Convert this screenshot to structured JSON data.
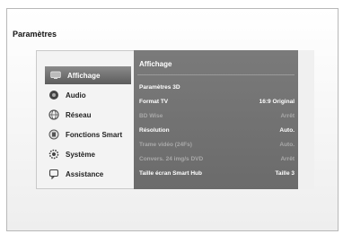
{
  "page": {
    "title": "Paramètres"
  },
  "menu": {
    "items": [
      {
        "label": "Affichage",
        "icon": "display-icon",
        "active": true
      },
      {
        "label": "Audio",
        "icon": "audio-icon",
        "active": false
      },
      {
        "label": "Réseau",
        "icon": "network-icon",
        "active": false
      },
      {
        "label": "Fonctions Smart",
        "icon": "smart-icon",
        "active": false
      },
      {
        "label": "Système",
        "icon": "gear-icon",
        "active": false
      },
      {
        "label": "Assistance",
        "icon": "support-icon",
        "active": false
      }
    ]
  },
  "panel": {
    "title": "Affichage",
    "rows": [
      {
        "label": "Paramètres 3D",
        "value": "",
        "enabled": true
      },
      {
        "label": "Format TV",
        "value": "16:9 Original",
        "enabled": true
      },
      {
        "label": "BD Wise",
        "value": "Arrêt",
        "enabled": false
      },
      {
        "label": "Résolution",
        "value": "Auto.",
        "enabled": true
      },
      {
        "label": "Trame vidéo (24Fs)",
        "value": "Auto.",
        "enabled": false
      },
      {
        "label": "Convers. 24 img/s DVD",
        "value": "Arrêt",
        "enabled": false
      },
      {
        "label": "Taille écran Smart Hub",
        "value": "Taille 3",
        "enabled": true
      }
    ]
  },
  "colors": {
    "panel_bg": "#707070",
    "text_light": "#ffffff",
    "text_dim": "#a9a9a9"
  }
}
